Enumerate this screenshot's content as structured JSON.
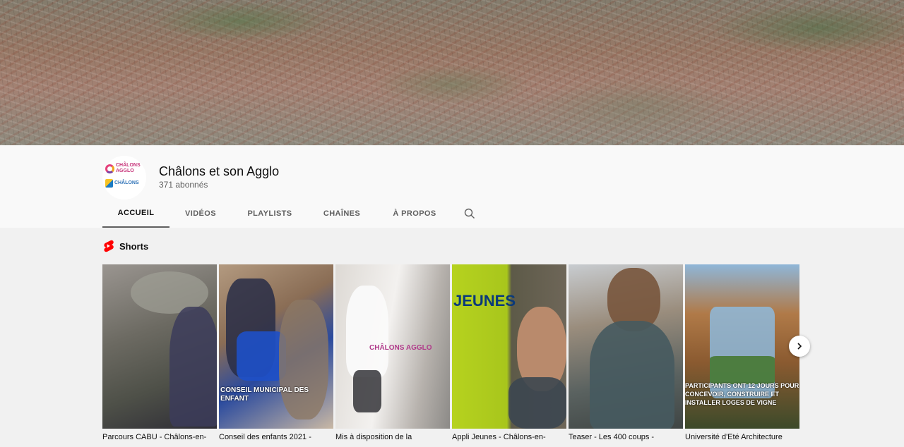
{
  "channel": {
    "name": "Châlons et son Agglo",
    "subscribers": "371 abonnés",
    "logo_line1": "CHÂLONS",
    "logo_line2": "AGGLO",
    "logo_line3": "CHÂLONS"
  },
  "tabs": [
    {
      "label": "ACCUEIL",
      "active": true
    },
    {
      "label": "VIDÉOS",
      "active": false
    },
    {
      "label": "PLAYLISTS",
      "active": false
    },
    {
      "label": "CHAÎNES",
      "active": false
    },
    {
      "label": "À PROPOS",
      "active": false
    }
  ],
  "shorts": {
    "title": "Shorts",
    "items": [
      {
        "title": "Parcours CABU - Châlons-en-",
        "overlay": ""
      },
      {
        "title": "Conseil des enfants 2021 -",
        "overlay": "CONSEIL MUNICIPAL DES ENFANT"
      },
      {
        "title": "Mis à disposition de la",
        "overlay": "CHÂLONS AGGLO"
      },
      {
        "title": "Appli Jeunes - Châlons-en-",
        "overlay": "JEUNES"
      },
      {
        "title": "Teaser - Les 400 coups -",
        "overlay": ""
      },
      {
        "title": "Université d'Eté Architecture",
        "overlay": "PARTICIPANTS ONT 12 JOURS POUR CONCEVOIR, CONSTRUIRE ET INSTALLER LOGES DE VIGNE"
      }
    ]
  },
  "colors": {
    "accent_red": "#ff0000",
    "text_primary": "#0f0f0f",
    "text_secondary": "#606060"
  }
}
